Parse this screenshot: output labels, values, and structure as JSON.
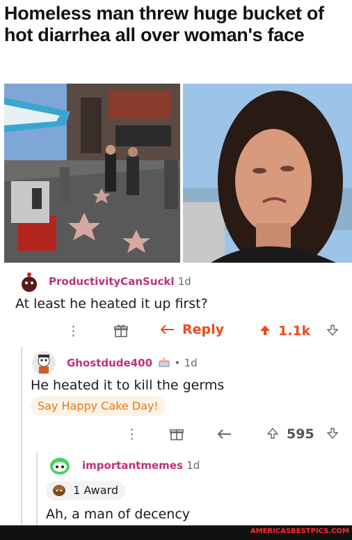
{
  "headline": "Homeless man threw huge bucket of hot diarrhea all over woman's face",
  "comments": [
    {
      "username": "ProductivityCanSuckl",
      "age": "1d",
      "text": "At least he heated it up first?",
      "actions": {
        "more": "⋮",
        "gift": "gift-icon",
        "reply_label": "Reply",
        "score": "1.1k"
      },
      "colors": {
        "username": "#c0307a",
        "upvoted": "#f04a16"
      }
    },
    {
      "username": "Ghostdude400",
      "flair_sep": "•",
      "age": "1d",
      "text": "He heated it to kill the germs",
      "pill": "Say Happy Cake Day!",
      "actions": {
        "more": "⋮",
        "score": "595"
      },
      "colors": {
        "pill_text": "#e07b1a"
      }
    },
    {
      "username": "importantmemes",
      "age": "1d",
      "award": "1 Award",
      "text": "Ah, a man of decency"
    }
  ],
  "watermark": "AMERICASBESTPICS.COM"
}
